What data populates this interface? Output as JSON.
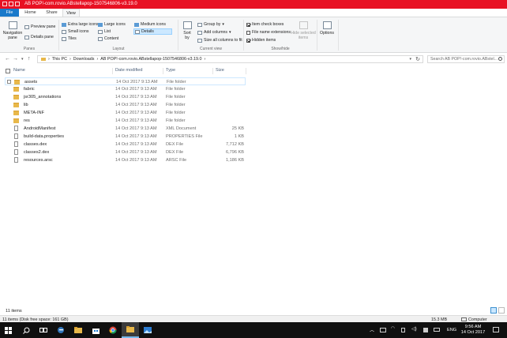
{
  "window": {
    "title": "AB POP!-com.rovio.ABstellapop-1507546806-v3.19.0",
    "accent": "#e81123"
  },
  "ribbon_tabs": [
    "File",
    "Home",
    "Share",
    "View"
  ],
  "ribbon": {
    "panes": {
      "group_label": "Panes",
      "navigation_pane": "Navigation pane",
      "preview_pane": "Preview pane",
      "details_pane": "Details pane"
    },
    "layout": {
      "group_label": "Layout",
      "extra_large_icons": "Extra large icons",
      "large_icons": "Large icons",
      "medium_icons": "Medium icons",
      "small_icons": "Small icons",
      "list": "List",
      "details": "Details",
      "tiles": "Tiles",
      "content": "Content"
    },
    "current_view": {
      "group_label": "Current view",
      "sort_by": "Sort by",
      "group_by": "Group by",
      "add_columns": "Add columns",
      "size_all_columns": "Size all columns to fit"
    },
    "show_hide": {
      "group_label": "Show/hide",
      "item_check_boxes": "Item check boxes",
      "file_name_extensions": "File name extensions",
      "hidden_items": "Hidden items",
      "hide_selected_items": "Hide selected items"
    },
    "options": "Options"
  },
  "address": {
    "breadcrumb": [
      "This PC",
      "Downloads",
      "AB POP!-com.rovio.ABstellapop-1507546806-v3.19.0"
    ],
    "search_placeholder": "Search AB POP!-com.rovio.ABstel..."
  },
  "columns": [
    "Name",
    "Date modified",
    "Type",
    "Size"
  ],
  "files": [
    {
      "name": "assets",
      "date": "14 Oct 2017 9:13 AM",
      "type": "File folder",
      "size": "",
      "kind": "folder"
    },
    {
      "name": "fabric",
      "date": "14 Oct 2017 9:13 AM",
      "type": "File folder",
      "size": "",
      "kind": "folder"
    },
    {
      "name": "jsr305_annotations",
      "date": "14 Oct 2017 9:13 AM",
      "type": "File folder",
      "size": "",
      "kind": "folder"
    },
    {
      "name": "lib",
      "date": "14 Oct 2017 9:13 AM",
      "type": "File folder",
      "size": "",
      "kind": "folder"
    },
    {
      "name": "META-INF",
      "date": "14 Oct 2017 9:13 AM",
      "type": "File folder",
      "size": "",
      "kind": "folder"
    },
    {
      "name": "res",
      "date": "14 Oct 2017 9:13 AM",
      "type": "File folder",
      "size": "",
      "kind": "folder"
    },
    {
      "name": "AndroidManifest",
      "date": "14 Oct 2017 9:13 AM",
      "type": "XML Document",
      "size": "25 KB",
      "kind": "file"
    },
    {
      "name": "build-data.properties",
      "date": "14 Oct 2017 9:13 AM",
      "type": "PROPERTIES File",
      "size": "1 KB",
      "kind": "file"
    },
    {
      "name": "classes.dex",
      "date": "14 Oct 2017 9:13 AM",
      "type": "DEX File",
      "size": "7,712 KB",
      "kind": "file"
    },
    {
      "name": "classes2.dex",
      "date": "14 Oct 2017 9:13 AM",
      "type": "DEX File",
      "size": "6,796 KB",
      "kind": "file"
    },
    {
      "name": "resources.arsc",
      "date": "14 Oct 2017 9:13 AM",
      "type": "ARSC File",
      "size": "1,186 KB",
      "kind": "file"
    }
  ],
  "status": {
    "item_count": "11 items",
    "disk_info": "11 items (Disk free space: 161 GB)",
    "size": "15.3 MB",
    "location": "Computer"
  },
  "taskbar": {
    "language": "ENG",
    "time": "9:56 AM",
    "date": "14 Oct 2017"
  }
}
